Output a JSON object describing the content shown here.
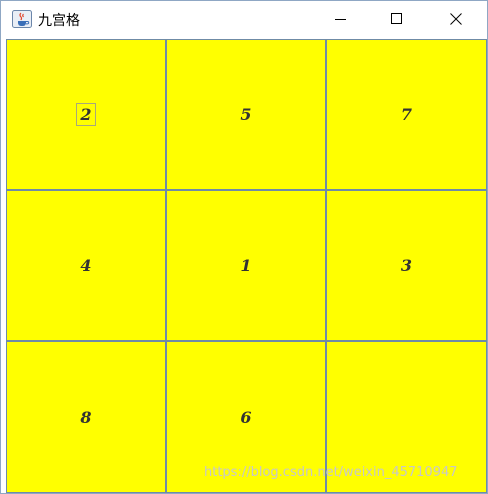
{
  "window": {
    "title": "九宫格",
    "controls": {
      "minimize": "minimize",
      "maximize": "maximize",
      "close": "close"
    }
  },
  "grid": {
    "cells": [
      {
        "label": "2",
        "focused": true
      },
      {
        "label": "5"
      },
      {
        "label": "7"
      },
      {
        "label": "4"
      },
      {
        "label": "1"
      },
      {
        "label": "3"
      },
      {
        "label": "8"
      },
      {
        "label": "6"
      },
      {
        "label": ""
      }
    ],
    "cell_color": "#ffff00",
    "grid_line_color": "#6f8ba6",
    "text_color": "#333333"
  },
  "watermark": "https://blog.csdn.net/weixin_45710947"
}
